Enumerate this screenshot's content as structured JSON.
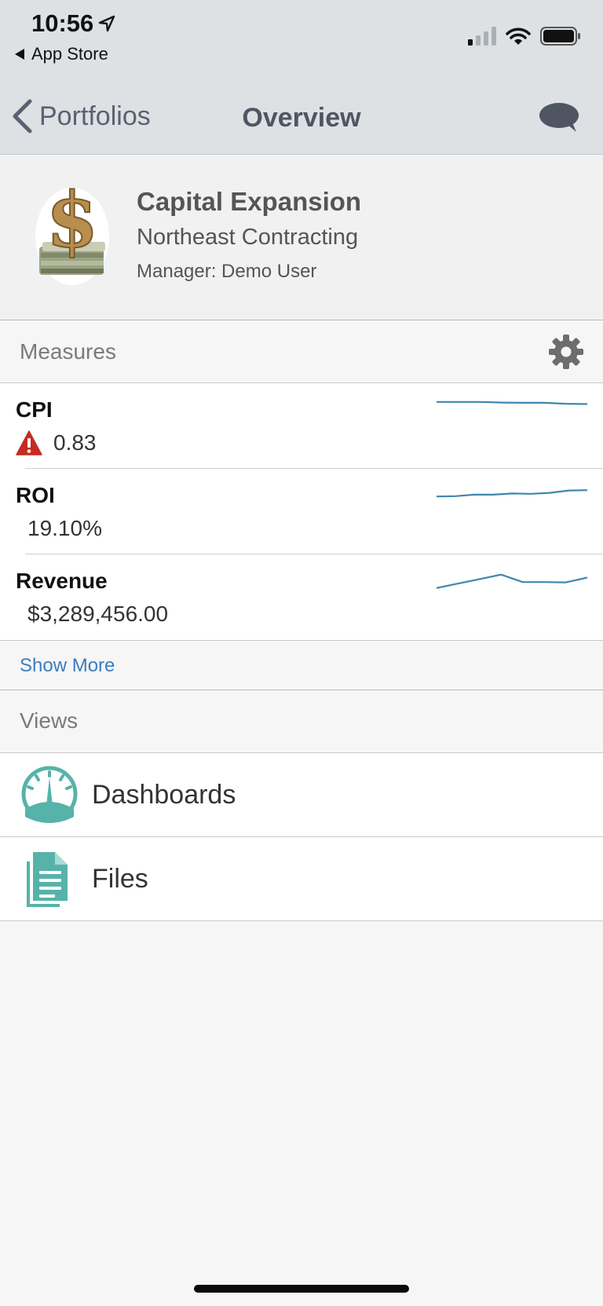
{
  "status_bar": {
    "time": "10:56",
    "back_app": "App Store"
  },
  "nav": {
    "back_label": "Portfolios",
    "title": "Overview",
    "chat_icon": "chat-bubble-icon"
  },
  "portfolio": {
    "title": "Capital Expansion",
    "subtitle": "Northeast Contracting",
    "manager": "Manager: Demo User",
    "logo_icon": "dollar-money-stack-icon"
  },
  "measures": {
    "header": "Measures",
    "settings_icon": "gear-icon",
    "items": [
      {
        "name": "CPI",
        "value": "0.83",
        "alert": true,
        "trend": [
          0.9,
          0.9,
          0.9,
          0.88,
          0.87,
          0.87,
          0.84,
          0.83
        ]
      },
      {
        "name": "ROI",
        "value": "19.10%",
        "alert": false,
        "trend": [
          0.6,
          0.61,
          0.66,
          0.66,
          0.7,
          0.69,
          0.72,
          0.8,
          0.81
        ]
      },
      {
        "name": "Revenue",
        "value": "$3,289,456.00",
        "alert": false,
        "trend": [
          0.4,
          0.55,
          0.7,
          0.85,
          0.6,
          0.6,
          0.59,
          0.75
        ]
      }
    ],
    "show_more": "Show More"
  },
  "views": {
    "header": "Views",
    "items": [
      {
        "label": "Dashboards",
        "icon": "dashboard-gauge-icon"
      },
      {
        "label": "Files",
        "icon": "files-icon"
      }
    ]
  },
  "colors": {
    "accent": "#3a7dc1",
    "sparkline": "#3f87ad",
    "view_icon": "#56b3a9",
    "alert": "#c62b22",
    "header_bg": "#dde1e4"
  }
}
